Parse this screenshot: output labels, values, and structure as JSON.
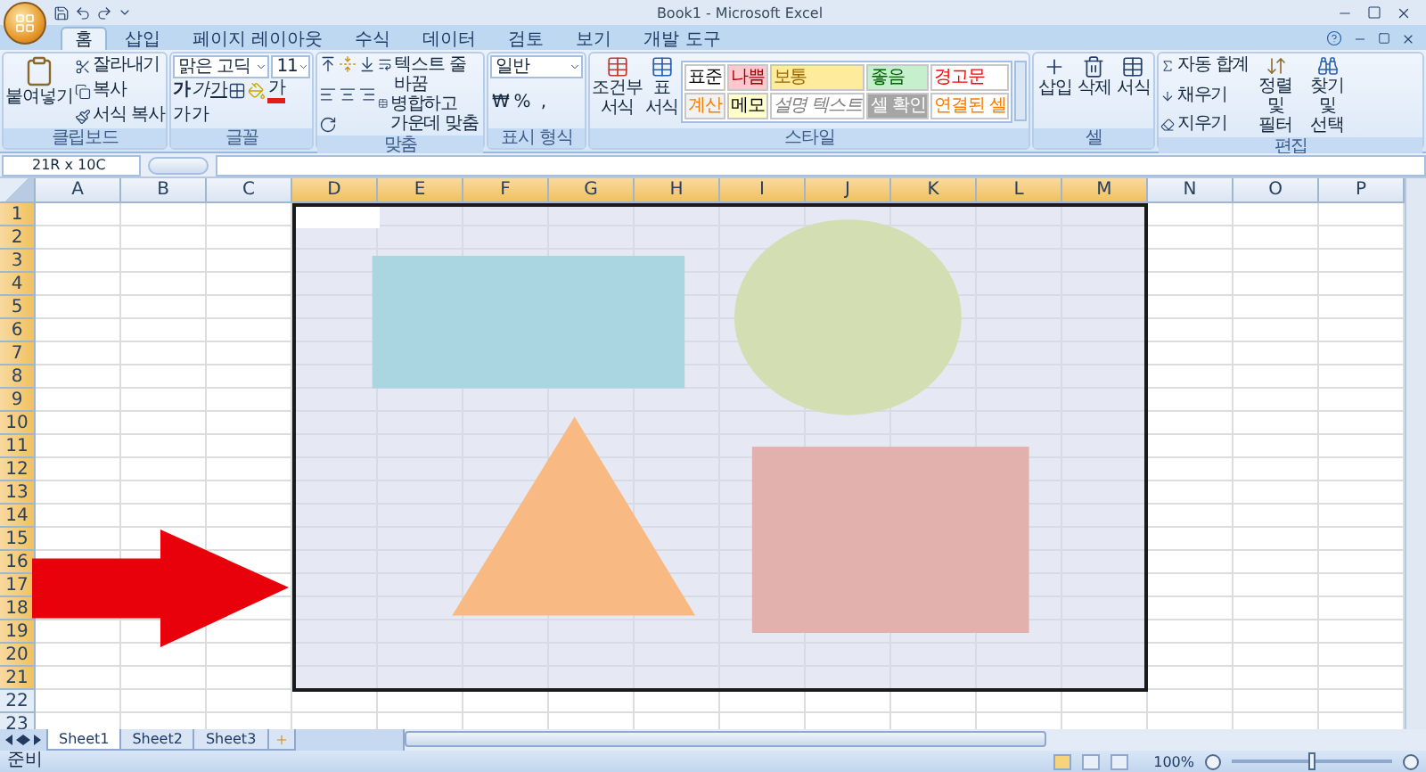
{
  "window": {
    "title": "Book1 - Microsoft Excel"
  },
  "tabs": [
    {
      "label": "홈",
      "selected": true
    },
    {
      "label": "삽입",
      "selected": false
    },
    {
      "label": "페이지 레이아웃",
      "selected": false
    },
    {
      "label": "수식",
      "selected": false
    },
    {
      "label": "데이터",
      "selected": false
    },
    {
      "label": "검토",
      "selected": false
    },
    {
      "label": "보기",
      "selected": false
    },
    {
      "label": "개발 도구",
      "selected": false
    }
  ],
  "ribbon": {
    "clipboard": {
      "label": "클립보드",
      "paste": "붙여넣기",
      "commands": [
        "잘라내기",
        "복사",
        "서식 복사"
      ]
    },
    "font": {
      "label": "글꼴",
      "font_name": "맑은 고딕",
      "font_size": "11",
      "grow": "가",
      "shrink": "가",
      "styles": [
        "가",
        "가",
        "가"
      ],
      "font_color": "가"
    },
    "alignment": {
      "label": "맞춤",
      "wrap": "텍스트 줄 바꿈",
      "merge": "병합하고 가운데 맞춤"
    },
    "number": {
      "label": "표시 형식",
      "format": "일반",
      "currency": "₩",
      "percent": "%",
      "comma": ","
    },
    "styles": {
      "label": "스타일",
      "conditional": "조건부 서식",
      "table": "표 서식",
      "cells": [
        {
          "label": "표준",
          "kind": "normal"
        },
        {
          "label": "계산",
          "kind": "calculation"
        },
        {
          "label": "나쁨",
          "kind": "bad"
        },
        {
          "label": "메모",
          "kind": "note"
        },
        {
          "label": "보통",
          "kind": "neutral"
        },
        {
          "label": "설명 텍스트",
          "kind": "explanatory"
        },
        {
          "label": "좋음",
          "kind": "good"
        },
        {
          "label": "셀 확인",
          "kind": "check"
        },
        {
          "label": "경고문",
          "kind": "warning"
        },
        {
          "label": "연결된 셀",
          "kind": "linked"
        }
      ]
    },
    "cells": {
      "label": "셀",
      "commands": [
        "삽입",
        "삭제",
        "서식"
      ]
    },
    "editing": {
      "label": "편집",
      "commands": [
        "자동 합계",
        "채우기",
        "지우기"
      ],
      "sort": "정렬 및 필터",
      "find": "찾기 및 선택"
    }
  },
  "formula_bar": {
    "name_box": "21R x 10C"
  },
  "columns": [
    {
      "label": "A",
      "selected": false
    },
    {
      "label": "B",
      "selected": false
    },
    {
      "label": "C",
      "selected": false
    },
    {
      "label": "D",
      "selected": true
    },
    {
      "label": "E",
      "selected": true
    },
    {
      "label": "F",
      "selected": true
    },
    {
      "label": "G",
      "selected": true
    },
    {
      "label": "H",
      "selected": true
    },
    {
      "label": "I",
      "selected": true
    },
    {
      "label": "J",
      "selected": true
    },
    {
      "label": "K",
      "selected": true
    },
    {
      "label": "L",
      "selected": true
    },
    {
      "label": "M",
      "selected": true
    },
    {
      "label": "N",
      "selected": false
    },
    {
      "label": "O",
      "selected": false
    },
    {
      "label": "P",
      "selected": false
    }
  ],
  "rows": [
    {
      "label": "1",
      "selected": true
    },
    {
      "label": "2",
      "selected": true
    },
    {
      "label": "3",
      "selected": true
    },
    {
      "label": "4",
      "selected": true
    },
    {
      "label": "5",
      "selected": true
    },
    {
      "label": "6",
      "selected": true
    },
    {
      "label": "7",
      "selected": true
    },
    {
      "label": "8",
      "selected": true
    },
    {
      "label": "9",
      "selected": true
    },
    {
      "label": "10",
      "selected": true
    },
    {
      "label": "11",
      "selected": true
    },
    {
      "label": "12",
      "selected": true
    },
    {
      "label": "13",
      "selected": true
    },
    {
      "label": "14",
      "selected": true
    },
    {
      "label": "15",
      "selected": true
    },
    {
      "label": "16",
      "selected": true
    },
    {
      "label": "17",
      "selected": true
    },
    {
      "label": "18",
      "selected": true
    },
    {
      "label": "19",
      "selected": true
    },
    {
      "label": "20",
      "selected": true
    },
    {
      "label": "21",
      "selected": true
    },
    {
      "label": "22",
      "selected": false
    },
    {
      "label": "23",
      "selected": false
    }
  ],
  "sheets": [
    {
      "label": "Sheet1",
      "selected": true
    },
    {
      "label": "Sheet2",
      "selected": false
    },
    {
      "label": "Sheet3",
      "selected": false
    }
  ],
  "status_bar": {
    "status": "준비",
    "zoom": "100%",
    "zoom_slider": {
      "level": 0.5
    }
  }
}
